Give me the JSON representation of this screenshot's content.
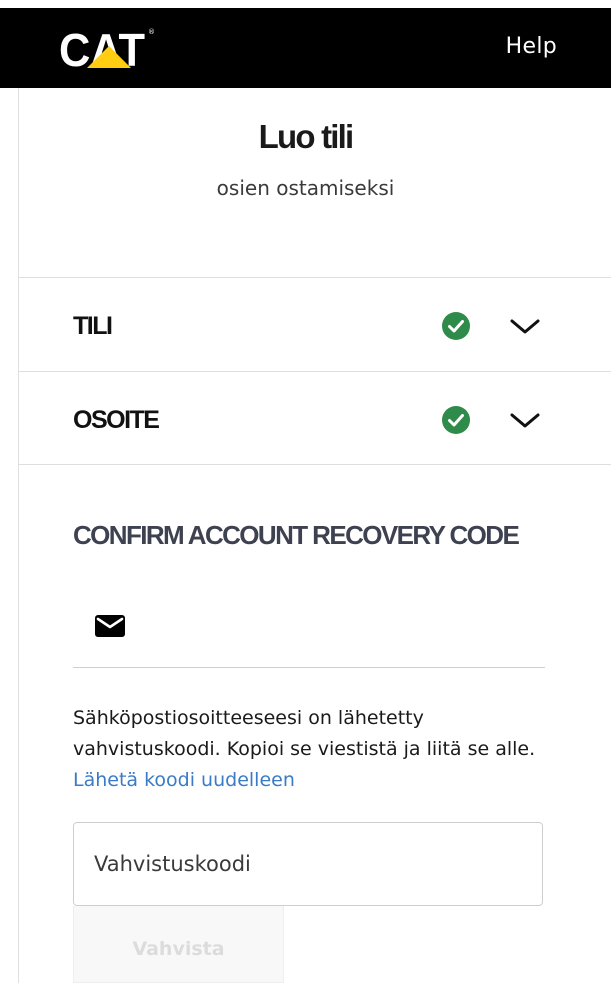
{
  "header": {
    "logo_text": "CAT",
    "help_label": "Help"
  },
  "page": {
    "title": "Luo tili",
    "subtitle": "osien ostamiseksi"
  },
  "sections": [
    {
      "label": "TILI",
      "status": "complete",
      "icon": "check-circle-icon",
      "expand_icon": "chevron-down-icon"
    },
    {
      "label": "OSOITE",
      "status": "complete",
      "icon": "check-circle-icon",
      "expand_icon": "chevron-down-icon"
    }
  ],
  "recovery": {
    "heading": "CONFIRM ACCOUNT RECOVERY CODE",
    "method_icon": "envelope-icon",
    "info_text": "Sähköpostiosoitteeseesi on lähetetty vahvistuskoodi. Kopioi se viestistä ja liitä se alle.",
    "resend_link": "Lähetä koodi uudelleen",
    "code_placeholder": "Vahvistuskoodi",
    "code_value": "",
    "verify_label": "Vahvista"
  },
  "colors": {
    "header_bg": "#000000",
    "brand_yellow": "#FFCD11",
    "success_green": "#2e8b4a",
    "link_blue": "#3a7bc8",
    "heading_slate": "#3d4150"
  }
}
